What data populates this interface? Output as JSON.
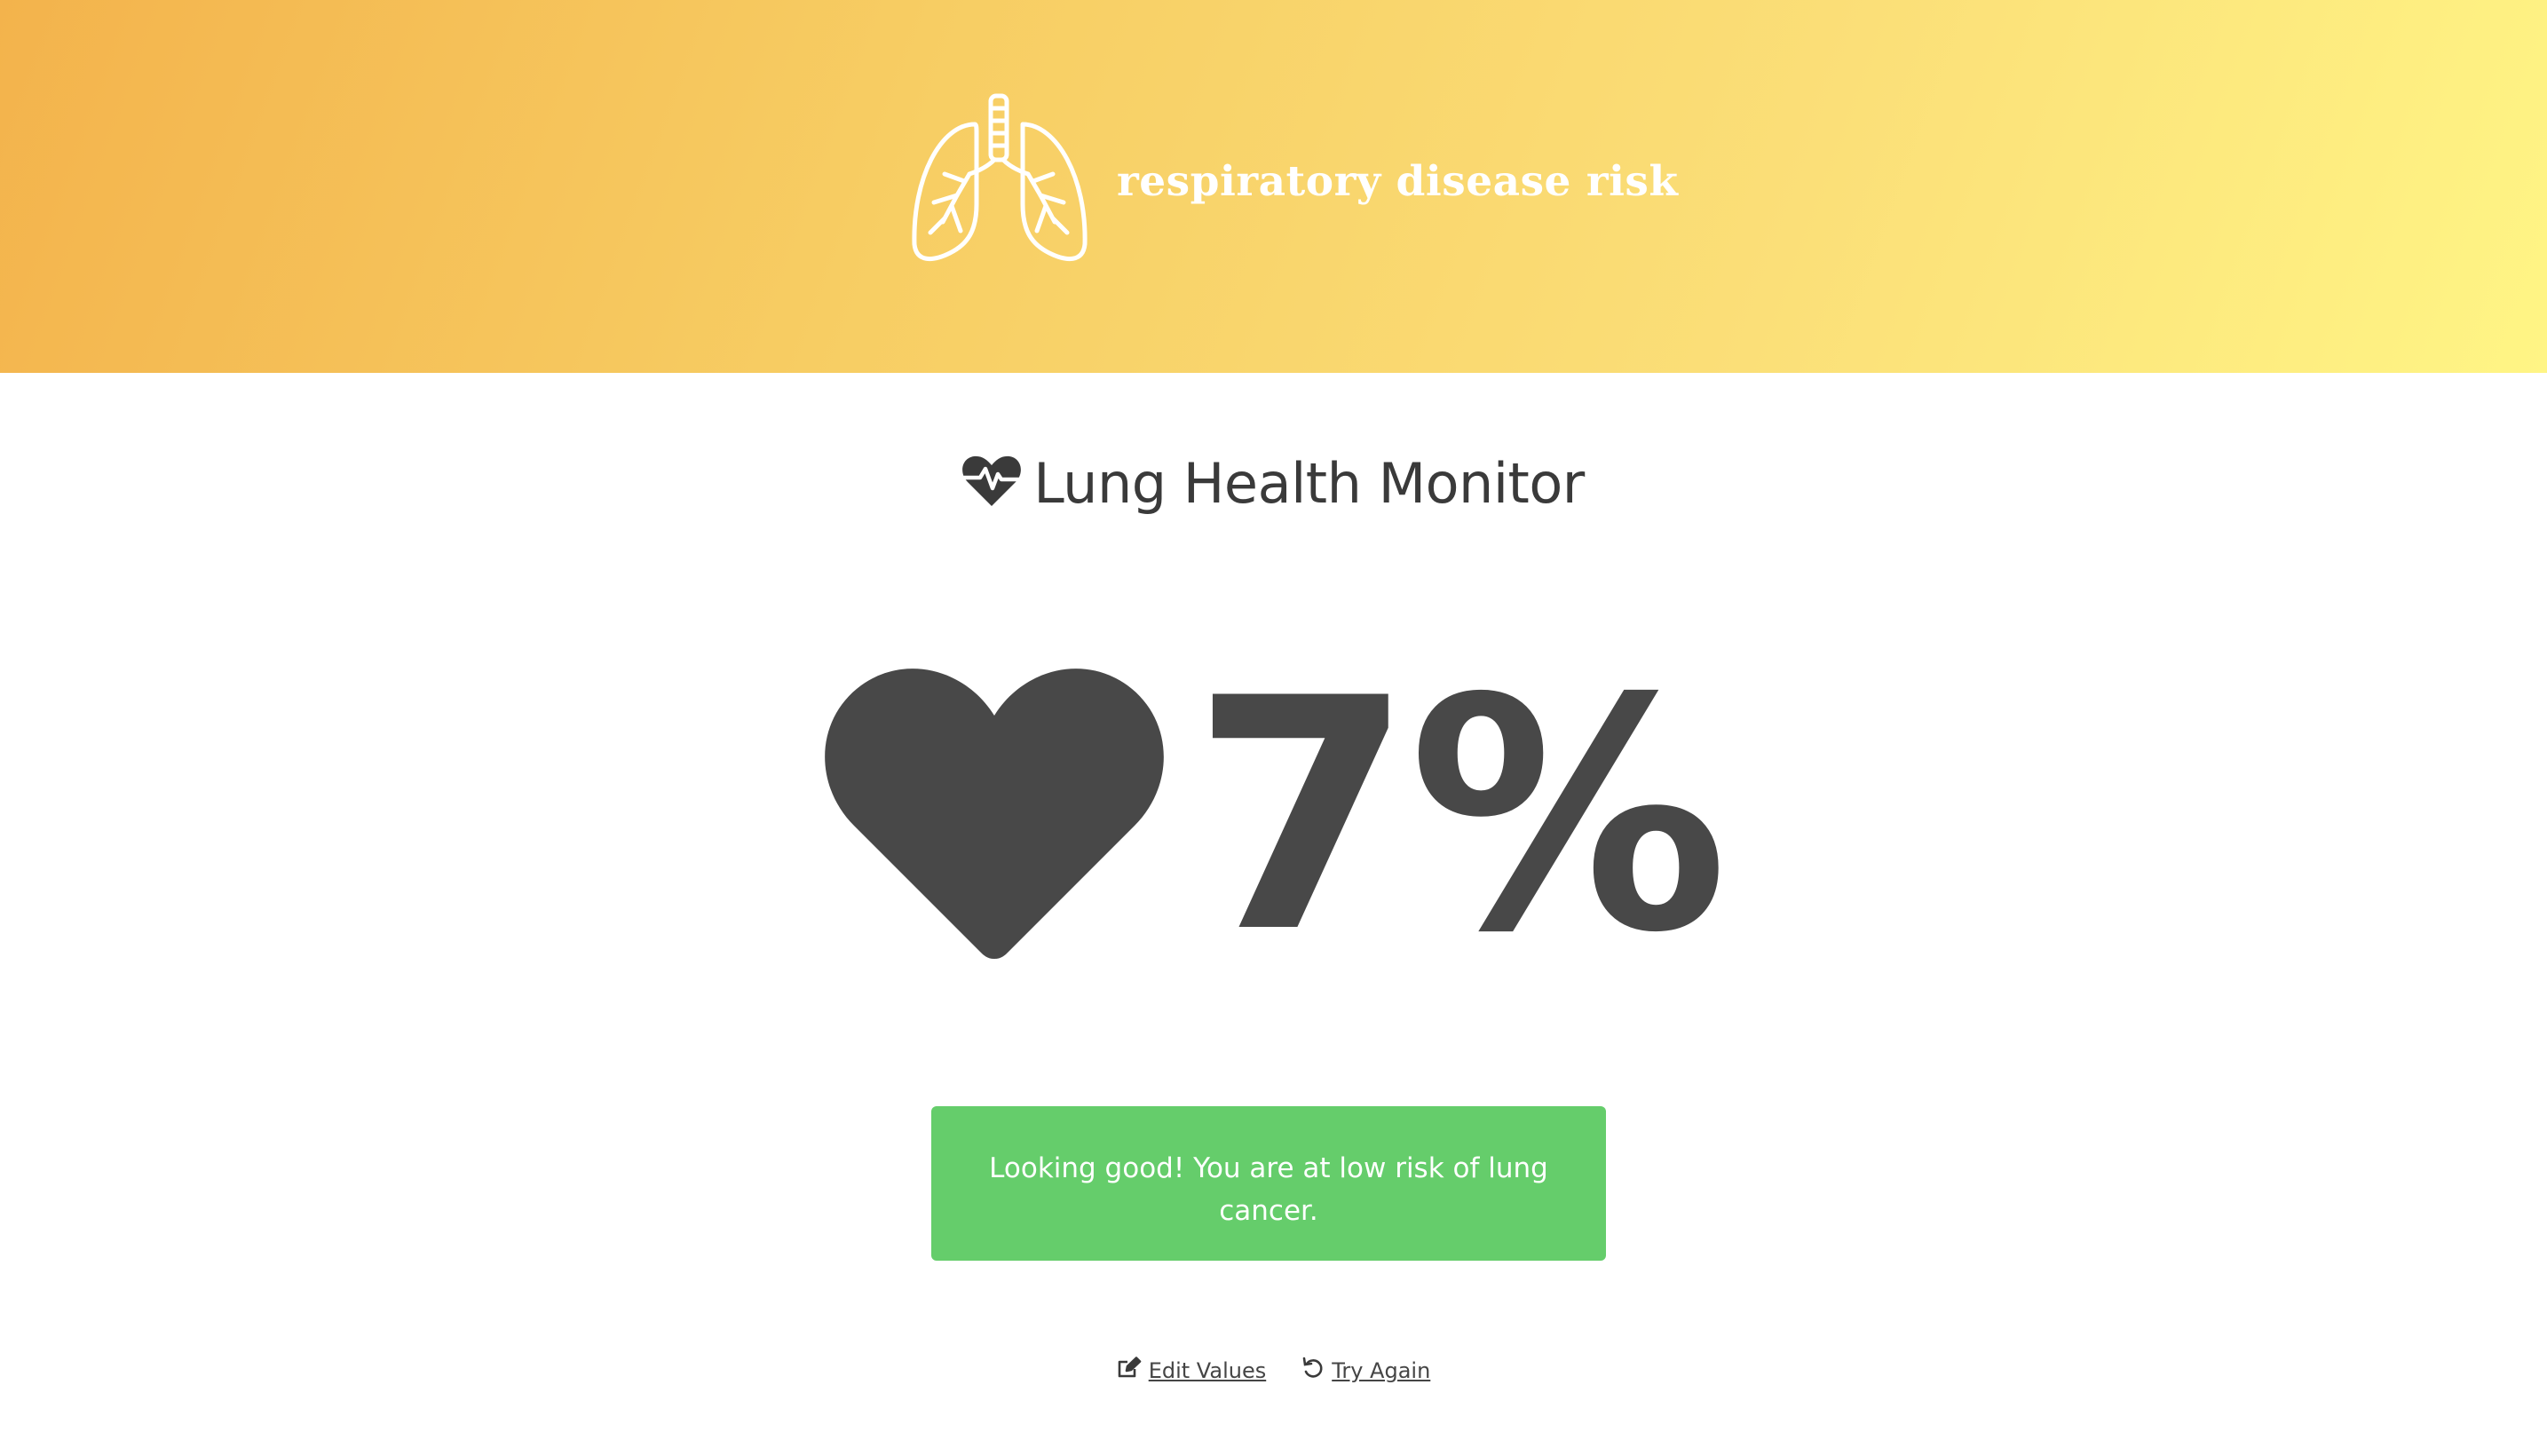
{
  "header": {
    "brand_text": "respiratory disease risk",
    "logo_icon": "lungs-icon",
    "gradient": [
      "#f3b34c",
      "#fff585"
    ]
  },
  "main": {
    "title_icon": "heartbeat-icon",
    "title": "Lung Health Monitor",
    "score_icon": "heart-icon",
    "risk_value": "7%",
    "alert": {
      "text": "Looking good! You are at low risk of lung cancer.",
      "color": "#65cd6b"
    }
  },
  "actions": {
    "edit_label": "Edit Values",
    "edit_icon": "edit-icon",
    "retry_label": "Try Again",
    "retry_icon": "undo-icon"
  }
}
